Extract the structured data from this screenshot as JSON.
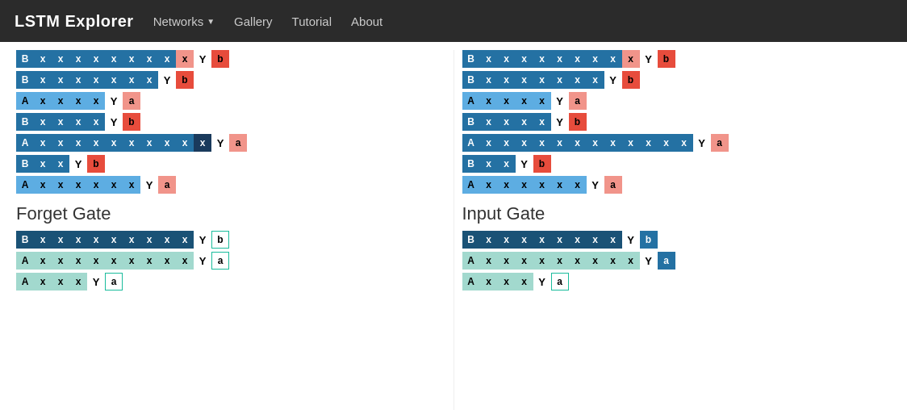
{
  "nav": {
    "brand": "LSTM Explorer",
    "links": [
      {
        "label": "Networks",
        "hasArrow": true
      },
      {
        "label": "Gallery",
        "hasArrow": false
      },
      {
        "label": "Tutorial",
        "hasArrow": false
      },
      {
        "label": "About",
        "hasArrow": false
      }
    ]
  },
  "sections": {
    "left_title": "Forget Gate",
    "right_title": "Input Gate"
  }
}
